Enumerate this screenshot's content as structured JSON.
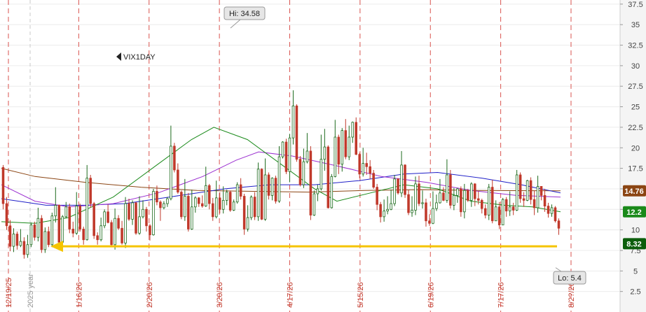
{
  "chart_data": {
    "type": "candlestick",
    "symbol": "VIX1DAY",
    "ylim": [
      0,
      38
    ],
    "y_ticks": [
      2.5,
      5,
      7.5,
      10,
      12.5,
      15,
      17.5,
      20,
      22.5,
      25,
      27.5,
      30,
      32.5,
      35,
      37.5
    ],
    "y_tick_labels": [
      "2.5",
      "5",
      "7.5",
      "10",
      "",
      "15",
      "17.5",
      "20",
      "22.5",
      "25",
      "27.5",
      "30",
      "32.5",
      "35",
      "37.5"
    ],
    "x_date_labels": [
      "12/19/25",
      "1/16/26",
      "2/20/26",
      "3/20/26",
      "4/17/26",
      "5/15/26",
      "6/19/26",
      "7/17/26",
      "8/2?/26"
    ],
    "x_date_label_colors": [
      "#c0392b",
      "#c0392b",
      "#c0392b",
      "#c0392b",
      "#c0392b",
      "#c0392b",
      "#c0392b",
      "#c0392b",
      "#c0392b"
    ],
    "year_marker_label": "2025 year",
    "hi_label": "Hi: 34.58",
    "hi_value": 34.58,
    "lo_label": "Lo: 5.4",
    "lo_value": 5.4,
    "horizontal_line_value": 8.0,
    "horizontal_line_color": "#f5c400",
    "price_badges": [
      {
        "value": 14.76,
        "label": "14.76",
        "color": "#8b4513"
      },
      {
        "value": 12.2,
        "label": "12.2",
        "color": "#1a8a1a"
      },
      {
        "value": 8.32,
        "label": "8.32",
        "color": "#0b5d0b"
      }
    ],
    "moving_averages": [
      {
        "color": "#8b4513",
        "points": [
          [
            0,
            17.5
          ],
          [
            0.06,
            16.5
          ],
          [
            0.15,
            15.8
          ],
          [
            0.25,
            15.2
          ],
          [
            0.35,
            14.8
          ],
          [
            0.45,
            14.7
          ],
          [
            0.55,
            14.6
          ],
          [
            0.65,
            14.8
          ],
          [
            0.75,
            14.9
          ],
          [
            0.85,
            14.8
          ],
          [
            1.0,
            14.76
          ]
        ]
      },
      {
        "color": "#1f1fc8",
        "points": [
          [
            0,
            13.8
          ],
          [
            0.08,
            13.0
          ],
          [
            0.15,
            13.0
          ],
          [
            0.22,
            13.2
          ],
          [
            0.3,
            14.0
          ],
          [
            0.4,
            15.0
          ],
          [
            0.48,
            15.5
          ],
          [
            0.56,
            15.5
          ],
          [
            0.64,
            16.0
          ],
          [
            0.72,
            16.8
          ],
          [
            0.78,
            17.0
          ],
          [
            0.86,
            16.3
          ],
          [
            0.93,
            15.5
          ],
          [
            1.0,
            14.5
          ]
        ]
      },
      {
        "color": "#9b30d0",
        "points": [
          [
            0,
            15.5
          ],
          [
            0.06,
            13.5
          ],
          [
            0.12,
            12.8
          ],
          [
            0.2,
            13.2
          ],
          [
            0.28,
            14.5
          ],
          [
            0.36,
            16.5
          ],
          [
            0.42,
            18.5
          ],
          [
            0.46,
            19.5
          ],
          [
            0.52,
            19.0
          ],
          [
            0.6,
            17.8
          ],
          [
            0.68,
            16.5
          ],
          [
            0.76,
            15.8
          ],
          [
            0.84,
            14.8
          ],
          [
            0.92,
            14.2
          ],
          [
            1.0,
            14.0
          ]
        ]
      },
      {
        "color": "#1a8a1a",
        "points": [
          [
            0,
            11.0
          ],
          [
            0.06,
            10.8
          ],
          [
            0.12,
            11.5
          ],
          [
            0.2,
            14.0
          ],
          [
            0.28,
            18.0
          ],
          [
            0.34,
            21.0
          ],
          [
            0.38,
            22.5
          ],
          [
            0.44,
            21.0
          ],
          [
            0.5,
            18.0
          ],
          [
            0.56,
            15.0
          ],
          [
            0.6,
            13.5
          ],
          [
            0.66,
            14.5
          ],
          [
            0.72,
            15.5
          ],
          [
            0.78,
            15.0
          ],
          [
            0.84,
            13.5
          ],
          [
            0.9,
            13.0
          ],
          [
            0.95,
            12.8
          ],
          [
            1.0,
            12.2
          ]
        ]
      }
    ],
    "candles": [
      [
        17.6,
        13.2,
        17.9,
        12.5
      ],
      [
        13.2,
        10.5,
        14.0,
        10.0
      ],
      [
        10.5,
        8.0,
        11.2,
        7.4
      ],
      [
        8.0,
        9.5,
        10.2,
        7.3
      ],
      [
        9.5,
        8.1,
        9.8,
        7.6
      ],
      [
        8.1,
        8.6,
        10.1,
        7.9
      ],
      [
        8.6,
        7.0,
        9.1,
        6.5
      ],
      [
        7.0,
        8.2,
        9.4,
        6.6
      ],
      [
        8.2,
        10.6,
        10.9,
        7.9
      ],
      [
        10.6,
        9.1,
        11.0,
        8.7
      ],
      [
        9.1,
        11.4,
        12.7,
        8.6
      ],
      [
        11.4,
        7.6,
        11.8,
        7.2
      ],
      [
        7.6,
        9.8,
        10.3,
        7.2
      ],
      [
        9.8,
        8.2,
        10.4,
        7.9
      ],
      [
        8.2,
        11.7,
        12.1,
        7.9
      ],
      [
        11.7,
        13.0,
        15.2,
        10.9
      ],
      [
        13.0,
        8.5,
        13.1,
        7.9
      ],
      [
        8.5,
        11.6,
        11.8,
        7.8
      ],
      [
        11.6,
        12.8,
        13.4,
        11.4
      ],
      [
        12.8,
        10.1,
        13.2,
        9.6
      ],
      [
        10.1,
        9.6,
        11.0,
        9.1
      ],
      [
        9.6,
        12.9,
        14.6,
        9.4
      ],
      [
        12.9,
        10.1,
        13.2,
        9.8
      ],
      [
        10.1,
        8.8,
        10.4,
        8.2
      ],
      [
        8.8,
        16.3,
        17.9,
        8.7
      ],
      [
        16.3,
        13.2,
        16.7,
        12.7
      ],
      [
        13.2,
        9.3,
        13.4,
        8.9
      ],
      [
        9.3,
        8.8,
        9.7,
        8.2
      ],
      [
        8.8,
        10.5,
        11.5,
        8.6
      ],
      [
        10.5,
        12.2,
        12.5,
        10.2
      ],
      [
        12.2,
        10.9,
        13.1,
        10.8
      ],
      [
        10.9,
        8.2,
        11.2,
        7.9
      ],
      [
        8.2,
        11.4,
        12.6,
        7.6
      ],
      [
        11.4,
        10.2,
        11.8,
        10.0
      ],
      [
        10.2,
        8.4,
        11.1,
        8.2
      ],
      [
        8.4,
        13.2,
        14.0,
        7.8
      ],
      [
        13.2,
        11.3,
        13.8,
        11.1
      ],
      [
        11.3,
        13.3,
        13.6,
        10.6
      ],
      [
        13.3,
        9.6,
        13.4,
        9.4
      ],
      [
        9.6,
        11.6,
        14.1,
        9.4
      ],
      [
        11.6,
        12.5,
        13.6,
        11.4
      ],
      [
        12.5,
        10.5,
        12.8,
        9.8
      ],
      [
        10.5,
        9.4,
        10.7,
        8.7
      ],
      [
        9.4,
        14.7,
        15.0,
        9.3
      ],
      [
        14.7,
        13.4,
        15.4,
        13.0
      ],
      [
        13.4,
        12.7,
        13.6,
        11.1
      ],
      [
        12.7,
        13.2,
        13.5,
        12.5
      ],
      [
        13.2,
        13.8,
        14.0,
        12.8
      ],
      [
        13.8,
        20.2,
        22.7,
        13.6
      ],
      [
        20.2,
        17.3,
        20.6,
        17.0
      ],
      [
        17.3,
        14.6,
        18.1,
        14.4
      ],
      [
        14.6,
        11.6,
        14.8,
        11.3
      ],
      [
        11.6,
        14.1,
        16.2,
        11.1
      ],
      [
        14.1,
        10.1,
        14.5,
        9.8
      ],
      [
        10.1,
        12.8,
        14.9,
        10.0
      ],
      [
        12.8,
        13.9,
        14.1,
        12.1
      ],
      [
        13.9,
        13.2,
        14.0,
        12.8
      ],
      [
        13.2,
        12.9,
        14.2,
        12.7
      ],
      [
        12.9,
        15.4,
        17.7,
        12.8
      ],
      [
        15.4,
        13.2,
        15.6,
        12.5
      ],
      [
        13.2,
        11.6,
        13.9,
        11.1
      ],
      [
        11.6,
        13.9,
        16.0,
        11.4
      ],
      [
        13.9,
        12.5,
        14.6,
        12.0
      ],
      [
        12.5,
        13.6,
        15.3,
        12.0
      ],
      [
        13.6,
        14.6,
        14.9,
        13.0
      ],
      [
        14.6,
        12.4,
        14.8,
        12.2
      ],
      [
        12.4,
        13.4,
        13.7,
        12.3
      ],
      [
        13.4,
        15.5,
        15.8,
        13.2
      ],
      [
        15.5,
        14.1,
        16.3,
        13.7
      ],
      [
        14.1,
        10.1,
        14.4,
        9.4
      ],
      [
        10.1,
        11.5,
        13.0,
        9.8
      ],
      [
        11.5,
        14.0,
        14.2,
        11.2
      ],
      [
        14.0,
        11.6,
        14.6,
        11.2
      ],
      [
        11.6,
        17.4,
        18.2,
        11.1
      ],
      [
        17.4,
        11.3,
        17.5,
        11.2
      ],
      [
        11.3,
        16.7,
        18.7,
        11.1
      ],
      [
        16.7,
        14.2,
        17.0,
        13.7
      ],
      [
        14.2,
        16.3,
        16.4,
        13.6
      ],
      [
        16.3,
        13.5,
        16.6,
        13.2
      ],
      [
        13.5,
        18.9,
        20.2,
        13.3
      ],
      [
        18.9,
        20.7,
        20.8,
        18.7
      ],
      [
        20.7,
        17.1,
        21.1,
        16.8
      ],
      [
        17.1,
        21.2,
        21.7,
        15.8
      ],
      [
        21.2,
        25.1,
        27.0,
        20.4
      ],
      [
        25.1,
        18.6,
        25.3,
        18.3
      ],
      [
        18.6,
        15.5,
        19.0,
        15.3
      ],
      [
        15.5,
        18.3,
        19.9,
        15.1
      ],
      [
        18.3,
        19.6,
        21.8,
        18.1
      ],
      [
        19.6,
        11.8,
        20.2,
        11.2
      ],
      [
        11.8,
        14.4,
        14.8,
        11.7
      ],
      [
        14.4,
        15.0,
        15.5,
        13.5
      ],
      [
        15.0,
        18.6,
        21.6,
        14.8
      ],
      [
        18.6,
        20.1,
        22.3,
        17.2
      ],
      [
        20.1,
        12.7,
        20.3,
        12.6
      ],
      [
        12.7,
        16.5,
        16.8,
        12.6
      ],
      [
        16.5,
        21.3,
        23.4,
        16.4
      ],
      [
        21.3,
        18.0,
        21.6,
        16.8
      ],
      [
        18.0,
        22.1,
        22.4,
        17.1
      ],
      [
        22.1,
        18.9,
        23.5,
        18.6
      ],
      [
        18.9,
        21.3,
        22.7,
        18.5
      ],
      [
        21.3,
        23.1,
        23.2,
        20.6
      ],
      [
        23.1,
        19.2,
        23.7,
        19.1
      ],
      [
        19.2,
        16.8,
        19.4,
        16.3
      ],
      [
        16.8,
        18.1,
        20.0,
        16.5
      ],
      [
        18.1,
        17.7,
        19.4,
        16.7
      ],
      [
        17.7,
        16.9,
        18.5,
        16.2
      ],
      [
        16.9,
        15.2,
        17.3,
        15.0
      ],
      [
        15.2,
        13.1,
        15.6,
        12.4
      ],
      [
        13.1,
        11.6,
        13.4,
        10.9
      ],
      [
        11.6,
        12.3,
        13.7,
        11.0
      ],
      [
        12.3,
        12.5,
        14.1,
        11.9
      ],
      [
        12.5,
        13.2,
        14.9,
        12.4
      ],
      [
        13.2,
        16.2,
        16.7,
        12.9
      ],
      [
        16.2,
        14.5,
        16.3,
        14.3
      ],
      [
        14.5,
        17.9,
        19.6,
        14.0
      ],
      [
        17.9,
        14.3,
        18.0,
        13.9
      ],
      [
        14.3,
        12.1,
        14.9,
        11.8
      ],
      [
        12.1,
        12.4,
        14.1,
        11.6
      ],
      [
        12.4,
        15.6,
        16.5,
        11.8
      ],
      [
        15.6,
        13.2,
        16.6,
        12.9
      ],
      [
        13.2,
        13.3,
        14.8,
        12.6
      ],
      [
        13.3,
        11.1,
        13.8,
        10.4
      ],
      [
        11.1,
        10.8,
        11.9,
        10.5
      ],
      [
        10.8,
        12.6,
        14.7,
        10.7
      ],
      [
        12.6,
        13.3,
        14.3,
        12.3
      ],
      [
        13.3,
        14.5,
        16.2,
        13.2
      ],
      [
        14.5,
        13.6,
        15.2,
        13.5
      ],
      [
        13.6,
        16.7,
        18.6,
        13.3
      ],
      [
        16.7,
        13.0,
        17.3,
        12.6
      ],
      [
        13.0,
        14.2,
        15.1,
        12.4
      ],
      [
        14.2,
        15.0,
        15.1,
        13.3
      ],
      [
        15.0,
        12.2,
        15.3,
        11.6
      ],
      [
        12.2,
        14.8,
        15.6,
        11.4
      ],
      [
        14.8,
        13.6,
        15.0,
        13.4
      ],
      [
        13.6,
        15.6,
        15.8,
        12.8
      ],
      [
        15.6,
        13.8,
        15.7,
        12.9
      ],
      [
        13.8,
        13.6,
        14.7,
        13.1
      ],
      [
        13.6,
        12.6,
        13.8,
        12.0
      ],
      [
        12.6,
        11.8,
        13.1,
        11.4
      ],
      [
        11.8,
        15.2,
        15.6,
        11.2
      ],
      [
        15.2,
        11.1,
        16.1,
        10.8
      ],
      [
        11.1,
        12.8,
        13.6,
        11.1
      ],
      [
        12.8,
        10.6,
        13.4,
        10.1
      ],
      [
        10.6,
        13.7,
        13.9,
        10.6
      ],
      [
        13.7,
        12.3,
        14.0,
        11.6
      ],
      [
        12.3,
        12.8,
        14.7,
        11.7
      ],
      [
        12.8,
        12.4,
        13.3,
        11.8
      ],
      [
        12.4,
        16.7,
        17.3,
        12.3
      ],
      [
        16.7,
        13.8,
        17.0,
        13.3
      ],
      [
        13.8,
        13.6,
        14.6,
        12.8
      ],
      [
        13.6,
        16.0,
        16.1,
        13.5
      ],
      [
        16.0,
        13.7,
        16.4,
        13.1
      ],
      [
        13.7,
        12.7,
        14.8,
        11.8
      ],
      [
        12.7,
        15.3,
        16.6,
        12.1
      ],
      [
        15.3,
        14.2,
        15.3,
        13.6
      ],
      [
        14.2,
        12.9,
        15.0,
        12.2
      ],
      [
        12.9,
        12.0,
        13.3,
        11.5
      ],
      [
        12.0,
        12.7,
        13.1,
        11.6
      ],
      [
        12.7,
        11.1,
        12.9,
        10.9
      ],
      [
        11.1,
        10.2,
        11.4,
        9.4
      ]
    ],
    "title": "",
    "xlabel": "",
    "ylabel": ""
  }
}
